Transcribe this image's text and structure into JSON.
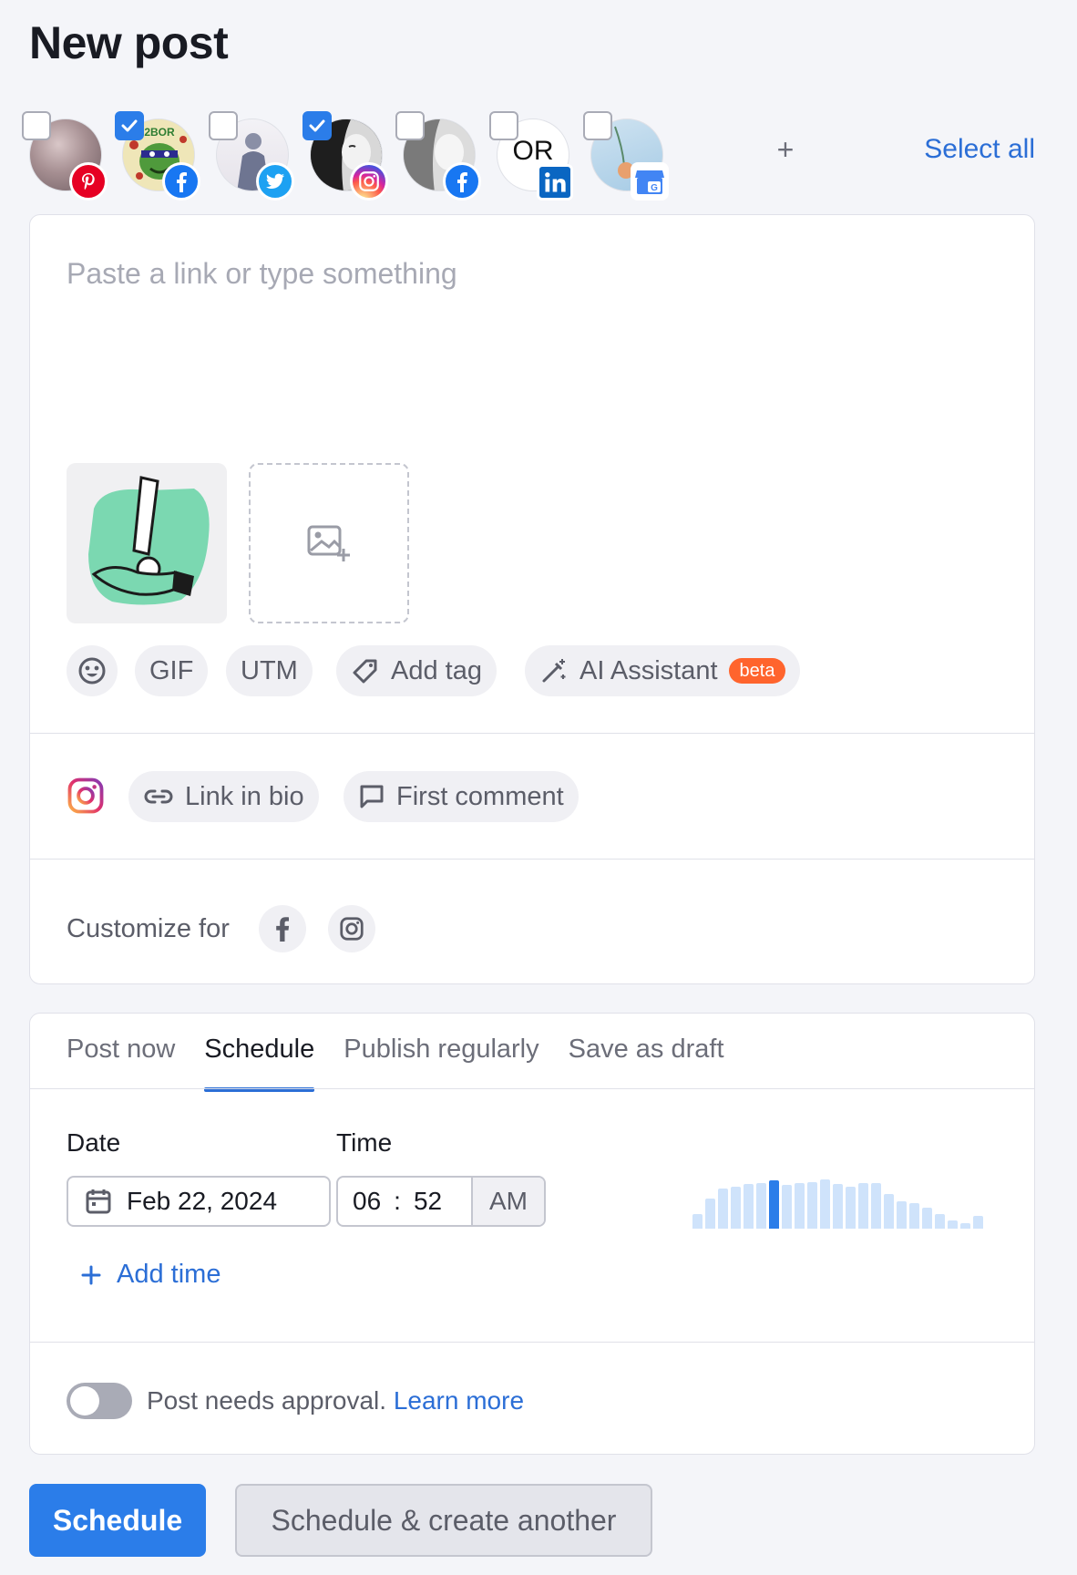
{
  "page": {
    "title": "New post"
  },
  "accounts": [
    {
      "network": "pinterest",
      "checked": false,
      "avatar": "scenic-avatar"
    },
    {
      "network": "facebook",
      "checked": true,
      "avatar": "cartoon-avatar",
      "avatar_text": "2BOR"
    },
    {
      "network": "twitter",
      "checked": false,
      "avatar": "person-avatar"
    },
    {
      "network": "instagram",
      "checked": true,
      "avatar": "portrait-avatar"
    },
    {
      "network": "facebook",
      "checked": false,
      "avatar": "portrait-avatar"
    },
    {
      "network": "linkedin",
      "checked": false,
      "avatar": "text-avatar",
      "avatar_text": "OR"
    },
    {
      "network": "google-business",
      "checked": false,
      "avatar": "scenic-avatar"
    }
  ],
  "accounts_more": "+",
  "select_all_label": "Select all",
  "composer": {
    "placeholder": "Paste a link or type something",
    "toolbar": {
      "gif_label": "GIF",
      "utm_label": "UTM",
      "add_tag_label": "Add tag",
      "ai_label": "AI Assistant",
      "ai_badge": "beta"
    },
    "instagram_options": {
      "link_in_bio_label": "Link in bio",
      "first_comment_label": "First comment"
    },
    "customize_label": "Customize for"
  },
  "schedule": {
    "tabs": [
      {
        "label": "Post now",
        "active": false
      },
      {
        "label": "Schedule",
        "active": true
      },
      {
        "label": "Publish regularly",
        "active": false
      },
      {
        "label": "Save as draft",
        "active": false
      }
    ],
    "date_label": "Date",
    "time_label": "Time",
    "date_value": "Feb 22, 2024",
    "hour": "06",
    "separator": ":",
    "minute": "52",
    "ampm": "AM",
    "add_time_label": "Add time",
    "activity_levels": [
      0.3,
      0.62,
      0.82,
      0.86,
      0.9,
      0.93,
      0.98,
      0.88,
      0.92,
      0.95,
      1.0,
      0.9,
      0.86,
      0.93,
      0.93,
      0.7,
      0.55,
      0.52,
      0.43,
      0.3,
      0.16,
      0.12,
      0.25
    ],
    "activity_highlight_index": 6,
    "approval_text": "Post needs approval.",
    "approval_link": "Learn more"
  },
  "footer": {
    "primary_label": "Schedule",
    "secondary_label": "Schedule & create another"
  },
  "colors": {
    "accent": "#2b7de9",
    "link": "#2b6ed6",
    "beta_badge": "#ff642d",
    "pinterest": "#e60023",
    "facebook": "#1877f2",
    "twitter": "#1da1f2",
    "linkedin": "#0a66c2",
    "google_business": "#4285f4"
  }
}
